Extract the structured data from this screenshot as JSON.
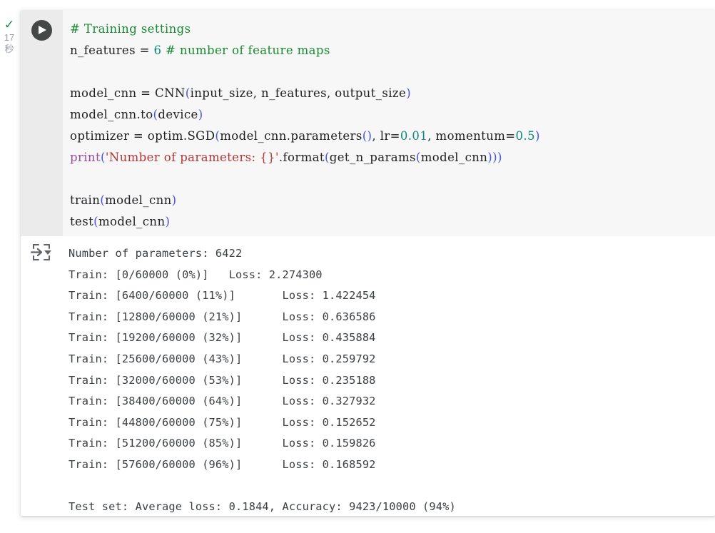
{
  "status": {
    "icon": "check-icon",
    "check_glyph": "✓",
    "duration_value": "17",
    "duration_unit": "秒",
    "color": "#1e8e3e"
  },
  "toolbar": {
    "run_button_label": "run-cell",
    "run_icon": "play-icon",
    "output_icon": "output-expand-icon"
  },
  "code_cell": {
    "language": "python",
    "background": "#f7f7f7",
    "lines": [
      {
        "tokens": [
          {
            "t": "# Training settings",
            "c": "com"
          }
        ]
      },
      {
        "tokens": [
          {
            "t": "n_features = ",
            "c": "pl"
          },
          {
            "t": "6",
            "c": "num"
          },
          {
            "t": " ",
            "c": "pl"
          },
          {
            "t": "# number of feature maps",
            "c": "com"
          }
        ]
      },
      {
        "tokens": [
          {
            "t": "",
            "c": "pl"
          }
        ]
      },
      {
        "tokens": [
          {
            "t": "model_cnn = CNN",
            "c": "pl"
          },
          {
            "t": "(",
            "c": "par"
          },
          {
            "t": "input_size, n_features, output_size",
            "c": "pl"
          },
          {
            "t": ")",
            "c": "par"
          }
        ]
      },
      {
        "tokens": [
          {
            "t": "model_cnn.to",
            "c": "pl"
          },
          {
            "t": "(",
            "c": "par"
          },
          {
            "t": "device",
            "c": "pl"
          },
          {
            "t": ")",
            "c": "par"
          }
        ]
      },
      {
        "tokens": [
          {
            "t": "optimizer = optim.SGD",
            "c": "pl"
          },
          {
            "t": "(",
            "c": "par"
          },
          {
            "t": "model_cnn.parameters",
            "c": "pl"
          },
          {
            "t": "()",
            "c": "par"
          },
          {
            "t": ", lr=",
            "c": "pl"
          },
          {
            "t": "0.01",
            "c": "num"
          },
          {
            "t": ", momentum=",
            "c": "pl"
          },
          {
            "t": "0.5",
            "c": "num"
          },
          {
            "t": ")",
            "c": "par"
          }
        ]
      },
      {
        "tokens": [
          {
            "t": "print",
            "c": "fn"
          },
          {
            "t": "(",
            "c": "par"
          },
          {
            "t": "'Number of parameters: {}'",
            "c": "str"
          },
          {
            "t": ".format",
            "c": "pl"
          },
          {
            "t": "(",
            "c": "par"
          },
          {
            "t": "get_n_params",
            "c": "pl"
          },
          {
            "t": "(",
            "c": "par"
          },
          {
            "t": "model_cnn",
            "c": "pl"
          },
          {
            "t": ")))",
            "c": "par"
          }
        ]
      },
      {
        "tokens": [
          {
            "t": "",
            "c": "pl"
          }
        ]
      },
      {
        "tokens": [
          {
            "t": "train",
            "c": "pl"
          },
          {
            "t": "(",
            "c": "par"
          },
          {
            "t": "model_cnn",
            "c": "pl"
          },
          {
            "t": ")",
            "c": "par"
          }
        ]
      },
      {
        "tokens": [
          {
            "t": "test",
            "c": "pl"
          },
          {
            "t": "(",
            "c": "par"
          },
          {
            "t": "model_cnn",
            "c": "pl"
          },
          {
            "t": ")",
            "c": "par"
          }
        ]
      }
    ]
  },
  "output_cell": {
    "background": "#ffffff",
    "text": "Number of parameters: 6422\nTrain: [0/60000 (0%)]\tLoss: 2.274300\nTrain: [6400/60000 (11%)]\tLoss: 1.422454\nTrain: [12800/60000 (21%)]\tLoss: 0.636586\nTrain: [19200/60000 (32%)]\tLoss: 0.435884\nTrain: [25600/60000 (43%)]\tLoss: 0.259792\nTrain: [32000/60000 (53%)]\tLoss: 0.235188\nTrain: [38400/60000 (64%)]\tLoss: 0.327932\nTrain: [44800/60000 (75%)]\tLoss: 0.152652\nTrain: [51200/60000 (85%)]\tLoss: 0.159826\nTrain: [57600/60000 (96%)]\tLoss: 0.168592\n\nTest set: Average loss: 0.1844, Accuracy: 9423/10000 (94%)",
    "summary": {
      "n_parameters": "6422",
      "test_average_loss": "0.1844",
      "test_correct": "9423",
      "test_total": "10000",
      "test_accuracy_pct": "94%"
    },
    "train_log": [
      {
        "seen": "0",
        "total": "60000",
        "pct": "0%",
        "loss": "2.274300"
      },
      {
        "seen": "6400",
        "total": "60000",
        "pct": "11%",
        "loss": "1.422454"
      },
      {
        "seen": "12800",
        "total": "60000",
        "pct": "21%",
        "loss": "0.636586"
      },
      {
        "seen": "19200",
        "total": "60000",
        "pct": "32%",
        "loss": "0.435884"
      },
      {
        "seen": "25600",
        "total": "60000",
        "pct": "43%",
        "loss": "0.259792"
      },
      {
        "seen": "32000",
        "total": "60000",
        "pct": "53%",
        "loss": "0.235188"
      },
      {
        "seen": "38400",
        "total": "60000",
        "pct": "64%",
        "loss": "0.327932"
      },
      {
        "seen": "44800",
        "total": "60000",
        "pct": "75%",
        "loss": "0.152652"
      },
      {
        "seen": "51200",
        "total": "60000",
        "pct": "85%",
        "loss": "0.159826"
      },
      {
        "seen": "57600",
        "total": "60000",
        "pct": "96%",
        "loss": "0.168592"
      }
    ]
  }
}
